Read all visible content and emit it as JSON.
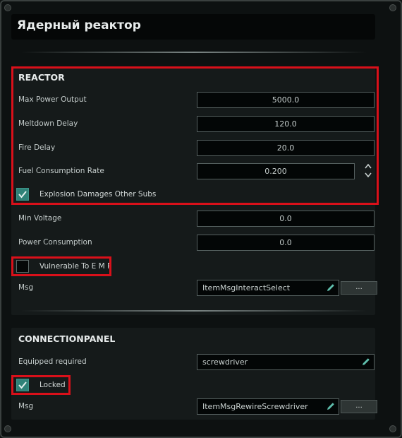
{
  "window": {
    "title": "Ядерный реактор"
  },
  "reactor": {
    "title": "REACTOR",
    "max_power_output": {
      "label": "Max Power Output",
      "value": "5000.0"
    },
    "meltdown_delay": {
      "label": "Meltdown Delay",
      "value": "120.0"
    },
    "fire_delay": {
      "label": "Fire Delay",
      "value": "20.0"
    },
    "fuel_consumption_rate": {
      "label": "Fuel Consumption Rate",
      "value": "0.200"
    },
    "explosion_damages": {
      "label": "Explosion Damages Other Subs",
      "checked": true
    },
    "min_voltage": {
      "label": "Min Voltage",
      "value": "0.0"
    },
    "power_consumption": {
      "label": "Power Consumption",
      "value": "0.0"
    },
    "vulnerable_to_emp": {
      "label": "Vulnerable To E M P",
      "checked": false
    },
    "msg": {
      "label": "Msg",
      "value": "ItemMsgInteractSelect",
      "button": "..."
    }
  },
  "connection_panel": {
    "title": "CONNECTIONPANEL",
    "equipped_required": {
      "label": "Equipped required",
      "value": "screwdriver"
    },
    "locked": {
      "label": "Locked",
      "checked": true
    },
    "msg": {
      "label": "Msg",
      "value": "ItemMsgRewireScrewdriver",
      "button": "..."
    }
  },
  "icons": {
    "edit": "pencil-icon",
    "check": "checkmark-icon",
    "stepper_up": "chevron-up-icon",
    "stepper_down": "chevron-down-icon"
  },
  "colors": {
    "highlight": "#d9101a",
    "checkbox_checked": "#2f8278",
    "accent_icon": "#5fbfad"
  }
}
